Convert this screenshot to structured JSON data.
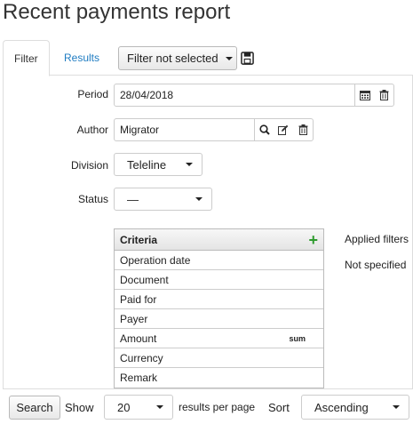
{
  "page": {
    "title": "Recent payments report"
  },
  "tabs": [
    {
      "label": "Filter",
      "active": true
    },
    {
      "label": "Results",
      "active": false
    }
  ],
  "filter_select": {
    "value": "Filter not selected"
  },
  "fields": {
    "period": {
      "label": "Period",
      "value": "28/04/2018"
    },
    "author": {
      "label": "Author",
      "value": "Migrator"
    },
    "division": {
      "label": "Division",
      "value": "Teleline"
    },
    "status": {
      "label": "Status",
      "value": "—"
    }
  },
  "criteria": {
    "header": "Criteria",
    "rows": [
      {
        "label": "Operation date",
        "tag": ""
      },
      {
        "label": "Document",
        "tag": ""
      },
      {
        "label": "Paid for",
        "tag": ""
      },
      {
        "label": "Payer",
        "tag": ""
      },
      {
        "label": "Amount",
        "tag": "sum"
      },
      {
        "label": "Currency",
        "tag": ""
      },
      {
        "label": "Remark",
        "tag": ""
      }
    ]
  },
  "applied_filters": {
    "title": "Applied filters",
    "value": "Not specified"
  },
  "bottom": {
    "search_label": "Search",
    "show_label": "Show",
    "per_page_value": "20",
    "per_page_suffix": "results per page",
    "sort_label": "Sort",
    "sort_value": "Ascending"
  },
  "colors": {
    "link": "#1f7cc2",
    "add": "#2e9b2e"
  },
  "icons": [
    "save-icon",
    "calendar-icon",
    "trash-icon",
    "search-icon",
    "edit-icon",
    "plus-icon",
    "chevron-down-icon"
  ]
}
